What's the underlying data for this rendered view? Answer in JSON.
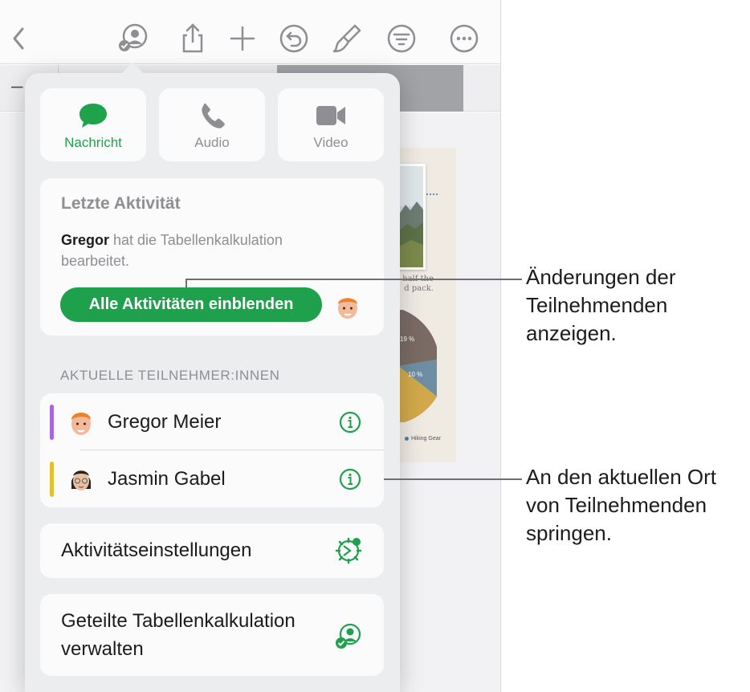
{
  "communication": {
    "message_label": "Nachricht",
    "audio_label": "Audio",
    "video_label": "Video"
  },
  "activity": {
    "title": "Letzte Aktivität",
    "user": "Gregor",
    "text": " hat die Tabellenkalkulation bearbeitet.",
    "show_all_button": "Alle Aktivitäten einblenden"
  },
  "participants": {
    "section_header": "AKTUELLE TEILNEHMER:INNEN",
    "list": [
      {
        "name": "Gregor Meier",
        "color": "#a667e0"
      },
      {
        "name": "Jasmin Gabel",
        "color": "#e3c02c"
      }
    ]
  },
  "settings": {
    "activity_settings_label": "Aktivitätseinstellungen",
    "manage_label": "Geteilte Tabellenkalkulation verwalten"
  },
  "document": {
    "caption": "half the\nd pack.",
    "pie_labels": [
      "19 %",
      "10 %"
    ],
    "legend_item": "Hiking Gear"
  },
  "callouts": {
    "changes": "Änderungen der Teilnehmenden anzeigen.",
    "jump": "An den aktuellen Ort von Teilnehmenden springen."
  },
  "colors": {
    "accent_green": "#1fa04d",
    "toolbar_gray": "#8e8e93"
  }
}
